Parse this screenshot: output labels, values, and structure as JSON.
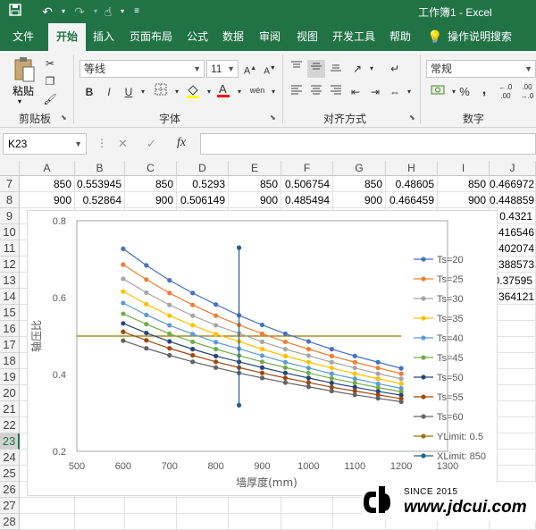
{
  "app": {
    "title": "工作簿1 - Excel",
    "quick_access": [
      "save-icon",
      "undo-icon",
      "redo-icon",
      "touch-mode-icon",
      "customize-icon"
    ]
  },
  "tabs": [
    "文件",
    "开始",
    "插入",
    "页面布局",
    "公式",
    "数据",
    "审阅",
    "视图",
    "开发工具",
    "帮助",
    "操作说明搜索"
  ],
  "active_tab": "开始",
  "ribbon": {
    "clipboard": {
      "paste_label": "粘贴",
      "group_label": "剪贴板"
    },
    "font": {
      "font_name": "等线",
      "font_size": "11",
      "bold": "B",
      "italic": "I",
      "underline": "U",
      "group_label": "字体"
    },
    "alignment": {
      "group_label": "对齐方式"
    },
    "number": {
      "format": "常规",
      "percent": "%",
      "comma": ",",
      "group_label": "数字"
    }
  },
  "formula_bar": {
    "name_box": "K23",
    "cancel": "✕",
    "enter": "✓",
    "fx": "fx",
    "formula": ""
  },
  "columns": [
    "A",
    "B",
    "C",
    "D",
    "E",
    "F",
    "G",
    "H",
    "I",
    "J"
  ],
  "rows": [
    {
      "num": "7",
      "cells": [
        "850",
        "0.553945",
        "850",
        "0.5293",
        "850",
        "0.506754",
        "850",
        "0.48605",
        "850",
        "0.466972"
      ]
    },
    {
      "num": "8",
      "cells": [
        "900",
        "0.52864",
        "900",
        "0.506149",
        "900",
        "0.485494",
        "900",
        "0.466459",
        "900",
        "0.448859"
      ]
    },
    {
      "num": "9",
      "cells": [
        "",
        "",
        "",
        "",
        "",
        "",
        "",
        "",
        "",
        "0.4321"
      ]
    },
    {
      "num": "10",
      "cells": [
        "",
        "",
        "",
        "",
        "",
        "",
        "",
        "",
        "",
        "0.416546"
      ]
    },
    {
      "num": "11",
      "cells": [
        "",
        "",
        "",
        "",
        "",
        "",
        "",
        "",
        "",
        "0.402074"
      ]
    },
    {
      "num": "12",
      "cells": [
        "",
        "",
        "",
        "",
        "",
        "",
        "",
        "",
        "",
        "0.388573"
      ]
    },
    {
      "num": "13",
      "cells": [
        "",
        "",
        "",
        "",
        "",
        "",
        "",
        "",
        "",
        "0.37595"
      ]
    },
    {
      "num": "14",
      "cells": [
        "",
        "",
        "",
        "",
        "",
        "",
        "",
        "",
        "",
        "0.364121"
      ]
    },
    {
      "num": "15",
      "cells": []
    },
    {
      "num": "16",
      "cells": []
    },
    {
      "num": "17",
      "cells": []
    },
    {
      "num": "18",
      "cells": []
    },
    {
      "num": "19",
      "cells": []
    },
    {
      "num": "20",
      "cells": []
    },
    {
      "num": "21",
      "cells": []
    },
    {
      "num": "22",
      "cells": []
    },
    {
      "num": "23",
      "cells": []
    },
    {
      "num": "24",
      "cells": []
    },
    {
      "num": "25",
      "cells": []
    },
    {
      "num": "26",
      "cells": []
    },
    {
      "num": "27",
      "cells": []
    },
    {
      "num": "28",
      "cells": []
    }
  ],
  "selected_row": "23",
  "watermark": {
    "since": "SINCE 2015",
    "site": "www.jdcui.com"
  },
  "chart_data": {
    "type": "scatter",
    "xlabel": "墙厚度(mm)",
    "ylabel": "轴压比",
    "xlim": [
      500,
      1300
    ],
    "ylim": [
      0.2,
      0.8
    ],
    "xticks": [
      "500",
      "600",
      "700",
      "800",
      "900",
      "1000",
      "1100",
      "1200",
      "1300"
    ],
    "yticks": [
      "0.2",
      "0.4",
      "0.6",
      "0.8"
    ],
    "x": [
      600,
      650,
      700,
      750,
      800,
      850,
      900,
      950,
      1000,
      1050,
      1100,
      1150,
      1200
    ],
    "series": [
      {
        "name": "Ts=20",
        "color": "#4472c4",
        "values": [
          0.727,
          0.684,
          0.645,
          0.612,
          0.582,
          0.554,
          0.529,
          0.506,
          0.486,
          0.466,
          0.448,
          0.432,
          0.416
        ]
      },
      {
        "name": "Ts=25",
        "color": "#ed7d31",
        "values": [
          0.686,
          0.647,
          0.612,
          0.581,
          0.553,
          0.529,
          0.506,
          0.485,
          0.466,
          0.448,
          0.432,
          0.417,
          0.402
        ]
      },
      {
        "name": "Ts=30",
        "color": "#a5a5a5",
        "values": [
          0.649,
          0.613,
          0.581,
          0.553,
          0.528,
          0.507,
          0.485,
          0.466,
          0.449,
          0.432,
          0.417,
          0.402,
          0.389
        ]
      },
      {
        "name": "Ts=35",
        "color": "#ffc000",
        "values": [
          0.616,
          0.583,
          0.553,
          0.528,
          0.505,
          0.486,
          0.466,
          0.448,
          0.432,
          0.417,
          0.402,
          0.389,
          0.376
        ]
      },
      {
        "name": "Ts=40",
        "color": "#5b9bd5",
        "values": [
          0.586,
          0.555,
          0.528,
          0.505,
          0.484,
          0.467,
          0.449,
          0.432,
          0.417,
          0.402,
          0.389,
          0.376,
          0.364
        ]
      },
      {
        "name": "Ts=45",
        "color": "#70ad47",
        "values": [
          0.558,
          0.531,
          0.506,
          0.485,
          0.466,
          0.449,
          0.433,
          0.418,
          0.404,
          0.39,
          0.378,
          0.366,
          0.355
        ]
      },
      {
        "name": "Ts=50",
        "color": "#264478",
        "values": [
          0.533,
          0.508,
          0.486,
          0.466,
          0.448,
          0.433,
          0.418,
          0.404,
          0.391,
          0.378,
          0.367,
          0.356,
          0.346
        ]
      },
      {
        "name": "Ts=55",
        "color": "#9e480e",
        "values": [
          0.511,
          0.489,
          0.468,
          0.45,
          0.433,
          0.418,
          0.404,
          0.391,
          0.379,
          0.367,
          0.357,
          0.347,
          0.337
        ]
      },
      {
        "name": "Ts=60",
        "color": "#636363",
        "values": [
          0.488,
          0.468,
          0.45,
          0.433,
          0.418,
          0.404,
          0.391,
          0.379,
          0.368,
          0.357,
          0.347,
          0.338,
          0.329
        ]
      }
    ],
    "ylimit_line": {
      "name": "YLimit: 0.5",
      "color": "#997300",
      "y": 0.5,
      "x": [
        500,
        1200
      ]
    },
    "xlimit_line": {
      "name": "XLimit: 850",
      "color": "#255e91",
      "x": 850,
      "y": [
        0.32,
        0.73
      ]
    },
    "legend": "right"
  }
}
